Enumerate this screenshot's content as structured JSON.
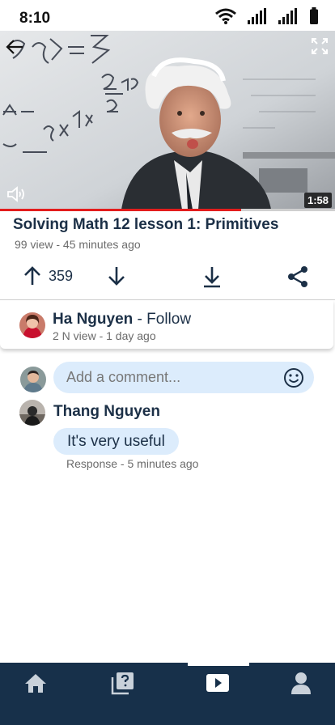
{
  "status_bar": {
    "time": "8:10"
  },
  "video": {
    "duration": "1:58",
    "progress": 0.72,
    "title": "Solving Math 12 lesson 1: Primitives",
    "meta": "99 view - 45 minutes ago"
  },
  "actions": {
    "upvote_count": "359"
  },
  "channel": {
    "name": "Ha Nguyen",
    "separator": " - ",
    "follow_label": "Follow",
    "meta": "2 N view - 1 day ago"
  },
  "comment_input": {
    "placeholder": "Add a comment..."
  },
  "comments": [
    {
      "author": "Thang Nguyen",
      "text": "It's very useful",
      "response_label": "Response",
      "meta_separator": " - ",
      "time": "5 minutes ago"
    }
  ],
  "bottom_nav": {
    "items": [
      "home-icon",
      "quiz-icon",
      "video-icon",
      "profile-icon"
    ],
    "active": "video-icon"
  },
  "colors": {
    "primary": "#17304a",
    "title_text": "#1c3047",
    "bubble_bg": "#dcecfc",
    "progress": "#e31d1d",
    "meta_text": "#6b6b6b"
  }
}
